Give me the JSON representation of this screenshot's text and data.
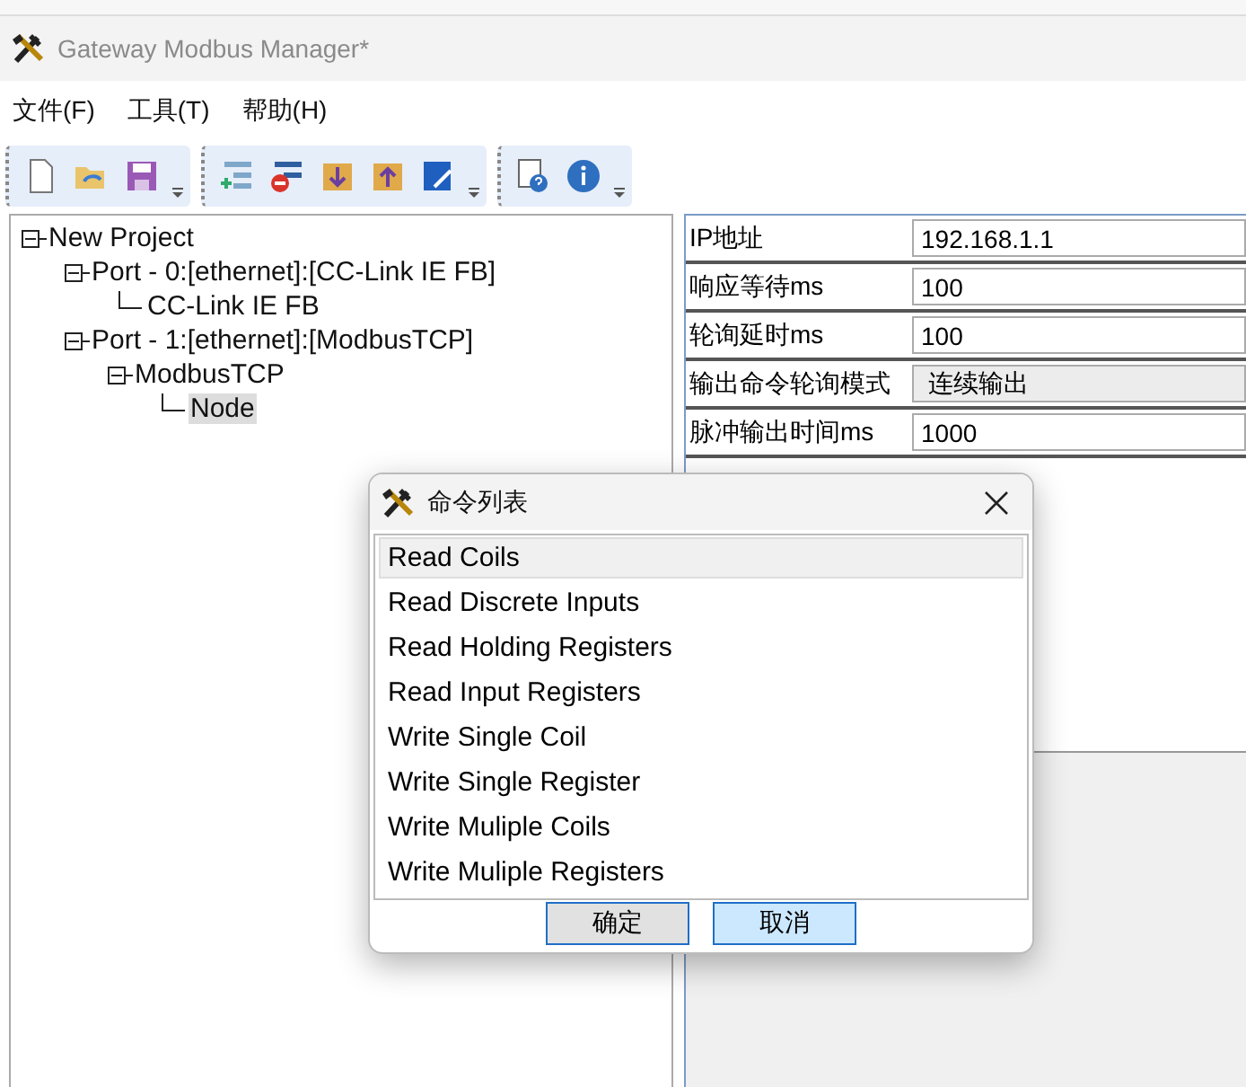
{
  "window": {
    "title": "Gateway Modbus Manager*"
  },
  "menu": [
    "文件(F)",
    "工具(T)",
    "帮助(H)"
  ],
  "toolbar": [
    {
      "tools": [
        {
          "kind": "new-file"
        },
        {
          "kind": "open-folder"
        },
        {
          "kind": "save"
        }
      ]
    },
    {
      "tools": [
        {
          "kind": "add-node"
        },
        {
          "kind": "remove-node"
        },
        {
          "kind": "download"
        },
        {
          "kind": "upload"
        },
        {
          "kind": "edit"
        }
      ]
    },
    {
      "tools": [
        {
          "kind": "help"
        },
        {
          "kind": "info"
        }
      ]
    }
  ],
  "tree": [
    {
      "label": "New Project",
      "expanded": true,
      "selected": false,
      "children": [
        {
          "label": "Port - 0:[ethernet]:[CC-Link IE FB]",
          "expanded": true,
          "selected": false,
          "children": [
            {
              "label": "CC-Link IE FB",
              "selected": false
            }
          ]
        },
        {
          "label": "Port - 1:[ethernet]:[ModbusTCP]",
          "expanded": true,
          "selected": false,
          "children": [
            {
              "label": "ModbusTCP",
              "expanded": true,
              "selected": false,
              "children": [
                {
                  "label": "Node",
                  "selected": true
                }
              ]
            }
          ]
        }
      ]
    }
  ],
  "properties": [
    {
      "label": "IP地址",
      "value": "192.168.1.1",
      "kind": "text"
    },
    {
      "label": "响应等待ms",
      "value": "100",
      "kind": "text"
    },
    {
      "label": "轮询延时ms",
      "value": "100",
      "kind": "text"
    },
    {
      "label": "输出命令轮询模式",
      "value": "连续输出",
      "kind": "select"
    },
    {
      "label": "脉冲输出时间ms",
      "value": "1000",
      "kind": "text"
    }
  ],
  "dialog": {
    "title": "命令列表",
    "items": [
      {
        "label": "Read Coils",
        "selected": true
      },
      {
        "label": "Read Discrete Inputs",
        "selected": false
      },
      {
        "label": "Read Holding Registers",
        "selected": false
      },
      {
        "label": "Read Input Registers",
        "selected": false
      },
      {
        "label": "Write Single Coil",
        "selected": false
      },
      {
        "label": "Write Single Register",
        "selected": false
      },
      {
        "label": "Write Muliple Coils",
        "selected": false
      },
      {
        "label": "Write Muliple Registers",
        "selected": false
      }
    ],
    "buttons": [
      {
        "label": "确定",
        "kind": "default"
      },
      {
        "label": "取消",
        "kind": "focused"
      }
    ]
  }
}
